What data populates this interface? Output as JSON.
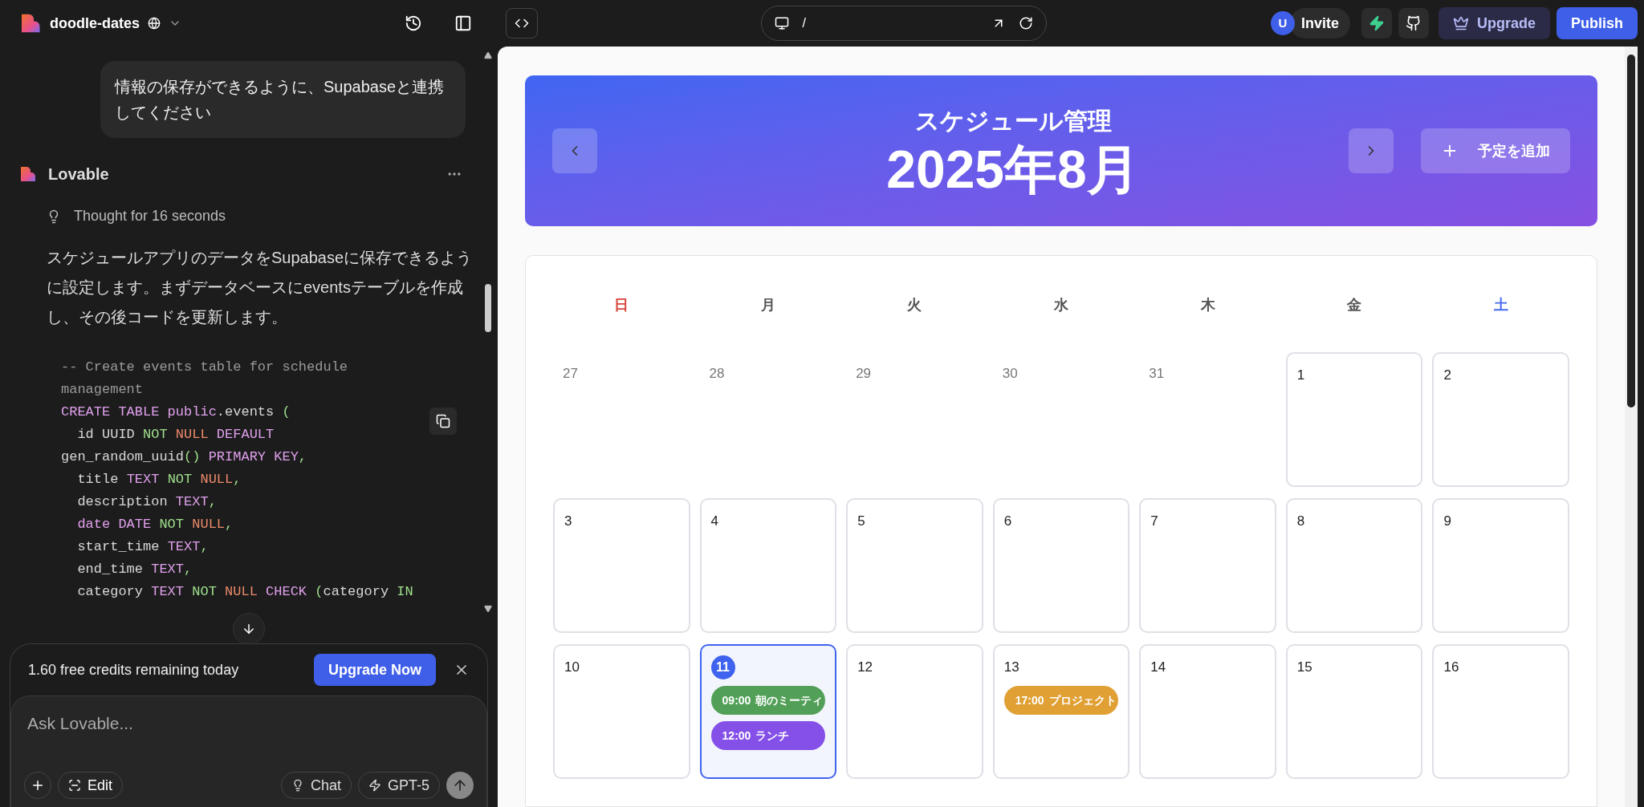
{
  "project": {
    "name": "doodle-dates"
  },
  "chat": {
    "user_message": "情報の保存ができるように、Supabaseと連携してください",
    "assistant": {
      "name": "Lovable",
      "thought": "Thought for 16 seconds",
      "text": "スケジュールアプリのデータをSupabaseに保存できるように設定します。まずデータベースにeventsテーブルを作成し、その後コードを更新します。",
      "code": [
        [
          {
            "t": "-- Create events table for schedule",
            "kind": "comment"
          }
        ],
        [
          {
            "t": "management",
            "kind": "comment"
          }
        ],
        [
          {
            "t": "CREATE TABLE public",
            "kind": "keyword"
          },
          {
            "t": ".events ",
            "kind": "plain"
          },
          {
            "t": "(",
            "kind": "green"
          }
        ],
        [
          {
            "t": "  id UUID ",
            "kind": "plain"
          },
          {
            "t": "NOT ",
            "kind": "green"
          },
          {
            "t": "NULL ",
            "kind": "orange"
          },
          {
            "t": "DEFAULT",
            "kind": "keyword"
          }
        ],
        [
          {
            "t": "gen_random_uuid",
            "kind": "plain"
          },
          {
            "t": "() ",
            "kind": "green"
          },
          {
            "t": "PRIMARY KEY",
            "kind": "keyword"
          },
          {
            "t": ",",
            "kind": "green"
          }
        ],
        [
          {
            "t": "  title ",
            "kind": "plain"
          },
          {
            "t": "TEXT ",
            "kind": "keyword"
          },
          {
            "t": "NOT ",
            "kind": "green"
          },
          {
            "t": "NULL",
            "kind": "orange"
          },
          {
            "t": ",",
            "kind": "green"
          }
        ],
        [
          {
            "t": "  description ",
            "kind": "plain"
          },
          {
            "t": "TEXT",
            "kind": "keyword"
          },
          {
            "t": ",",
            "kind": "green"
          }
        ],
        [
          {
            "t": "  date DATE ",
            "kind": "keyword"
          },
          {
            "t": "NOT ",
            "kind": "green"
          },
          {
            "t": "NULL",
            "kind": "orange"
          },
          {
            "t": ",",
            "kind": "green"
          }
        ],
        [
          {
            "t": "  start_time ",
            "kind": "plain"
          },
          {
            "t": "TEXT",
            "kind": "keyword"
          },
          {
            "t": ",",
            "kind": "green"
          }
        ],
        [
          {
            "t": "  end_time ",
            "kind": "plain"
          },
          {
            "t": "TEXT",
            "kind": "keyword"
          },
          {
            "t": ",",
            "kind": "green"
          }
        ],
        [
          {
            "t": "  category ",
            "kind": "plain"
          },
          {
            "t": "TEXT ",
            "kind": "keyword"
          },
          {
            "t": "NOT ",
            "kind": "green"
          },
          {
            "t": "NULL ",
            "kind": "orange"
          },
          {
            "t": "CHECK ",
            "kind": "keyword"
          },
          {
            "t": "(",
            "kind": "green"
          },
          {
            "t": "category ",
            "kind": "plain"
          },
          {
            "t": "IN",
            "kind": "green"
          }
        ]
      ]
    }
  },
  "credits": {
    "text": "1.60 free credits remaining today",
    "button": "Upgrade Now"
  },
  "composer": {
    "placeholder": "Ask Lovable...",
    "edit": "Edit",
    "chat": "Chat",
    "model": "GPT-5"
  },
  "toolbar": {
    "path": "/",
    "avatar": "U",
    "invite": "Invite",
    "upgrade": "Upgrade",
    "publish": "Publish"
  },
  "calendar": {
    "title": "スケジュール管理",
    "month": "2025年8月",
    "add_button": "予定を追加",
    "weekdays": [
      {
        "label": "日",
        "kind": "sunday"
      },
      {
        "label": "月",
        "kind": "weekday"
      },
      {
        "label": "火",
        "kind": "weekday"
      },
      {
        "label": "水",
        "kind": "weekday"
      },
      {
        "label": "木",
        "kind": "weekday"
      },
      {
        "label": "金",
        "kind": "weekday"
      },
      {
        "label": "土",
        "kind": "saturday"
      }
    ],
    "weeks": [
      [
        {
          "day": "27",
          "in_month": false,
          "today": false
        },
        {
          "day": "28",
          "in_month": false,
          "today": false
        },
        {
          "day": "29",
          "in_month": false,
          "today": false
        },
        {
          "day": "30",
          "in_month": false,
          "today": false
        },
        {
          "day": "31",
          "in_month": false,
          "today": false
        },
        {
          "day": "1",
          "in_month": true,
          "today": false
        },
        {
          "day": "2",
          "in_month": true,
          "today": false
        }
      ],
      [
        {
          "day": "3",
          "in_month": true,
          "today": false
        },
        {
          "day": "4",
          "in_month": true,
          "today": false
        },
        {
          "day": "5",
          "in_month": true,
          "today": false
        },
        {
          "day": "6",
          "in_month": true,
          "today": false
        },
        {
          "day": "7",
          "in_month": true,
          "today": false
        },
        {
          "day": "8",
          "in_month": true,
          "today": false
        },
        {
          "day": "9",
          "in_month": true,
          "today": false
        }
      ],
      [
        {
          "day": "10",
          "in_month": true,
          "today": false
        },
        {
          "day": "11",
          "in_month": true,
          "today": true,
          "events": [
            {
              "time": "09:00",
              "title": "朝のミーティ",
              "color": "#52a058"
            },
            {
              "time": "12:00",
              "title": "ランチ",
              "color": "#8450e8"
            }
          ]
        },
        {
          "day": "12",
          "in_month": true,
          "today": false
        },
        {
          "day": "13",
          "in_month": true,
          "today": false,
          "events": [
            {
              "time": "17:00",
              "title": "プロジェクト",
              "color": "#e0a034"
            }
          ]
        },
        {
          "day": "14",
          "in_month": true,
          "today": false
        },
        {
          "day": "15",
          "in_month": true,
          "today": false
        },
        {
          "day": "16",
          "in_month": true,
          "today": false
        }
      ]
    ]
  }
}
